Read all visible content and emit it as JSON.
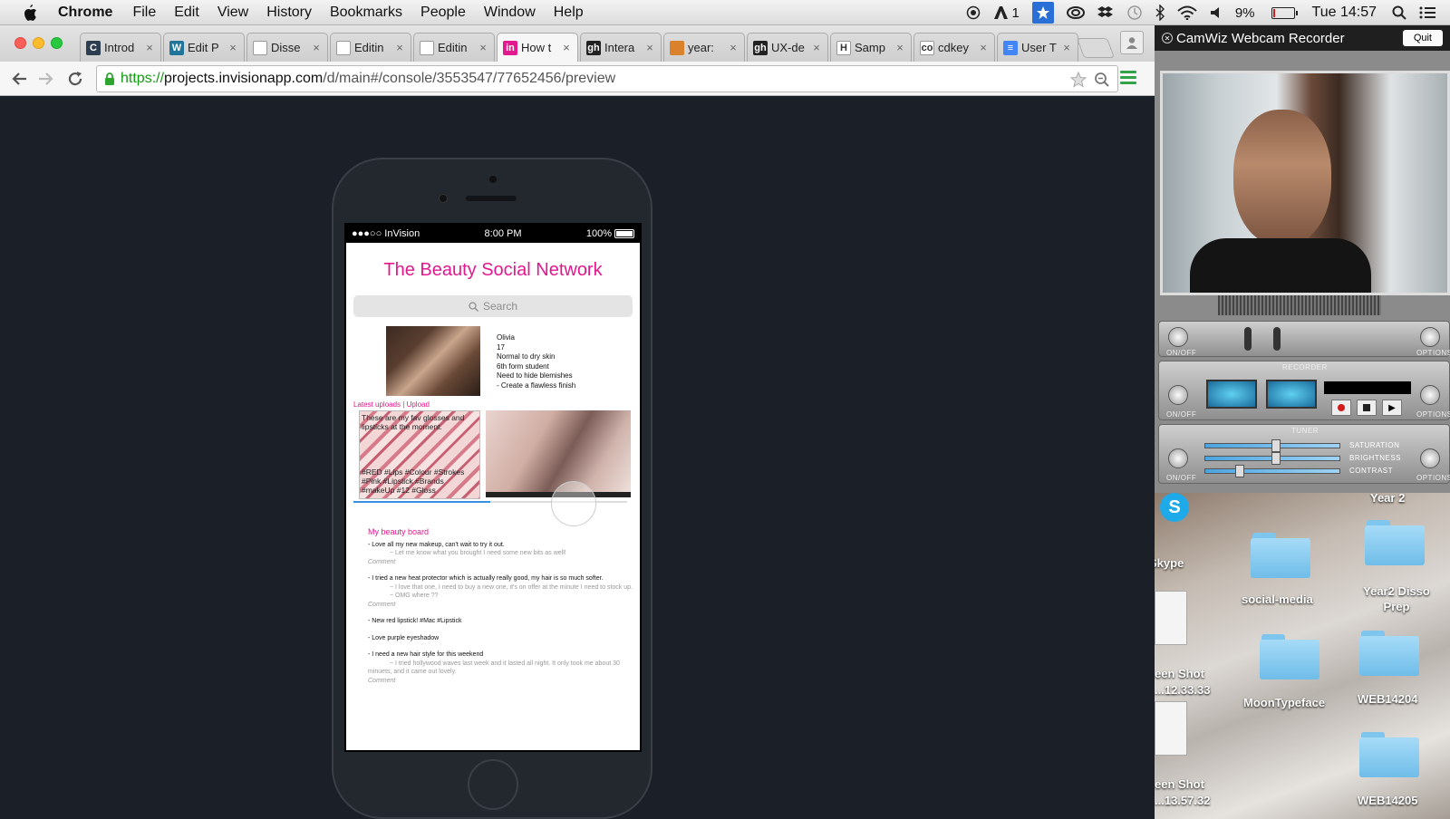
{
  "menubar": {
    "app": "Chrome",
    "items": [
      "File",
      "Edit",
      "View",
      "History",
      "Bookmarks",
      "People",
      "Window",
      "Help"
    ],
    "status": {
      "adobe_count": "1",
      "battery": "9%",
      "battery_level": 0.09,
      "clock": "Tue 14:57"
    }
  },
  "browser": {
    "tabs": [
      {
        "label": "Introd",
        "icon": "C",
        "color": "#2c3e50"
      },
      {
        "label": "Edit P",
        "icon": "W",
        "color": "#21759b"
      },
      {
        "label": "Disse",
        "icon": "",
        "color": "#ffffff"
      },
      {
        "label": "Editin",
        "icon": "",
        "color": "#ffffff"
      },
      {
        "label": "Editin",
        "icon": "",
        "color": "#ffffff"
      },
      {
        "label": "How t",
        "icon": "in",
        "color": "#e2188e"
      },
      {
        "label": "Intera",
        "icon": "gh",
        "color": "#222222"
      },
      {
        "label": "year: ",
        "icon": "",
        "color": "#d9822b"
      },
      {
        "label": "UX-de",
        "icon": "gh",
        "color": "#222222"
      },
      {
        "label": "Samp",
        "icon": "H",
        "color": "#ffffff"
      },
      {
        "label": "cdkey",
        "icon": "co",
        "color": "#ffffff"
      },
      {
        "label": "User T",
        "icon": "≡",
        "color": "#4285f4"
      }
    ],
    "active_tab": 5,
    "url": {
      "scheme": "https://",
      "host": "projects.invisionapp.com",
      "path": "/d/main#/console/3553547/77652456/preview"
    }
  },
  "phone": {
    "status": {
      "carrier": "●●●○○ InVision",
      "time": "8:00 PM",
      "battery": "100%"
    },
    "title": "The Beauty Social Network",
    "search_placeholder": "Search",
    "profile": {
      "name": "Olivia",
      "age": "17",
      "skin": "Normal to dry skin",
      "occupation": "6th form student",
      "need": "Need to hide blemishes",
      "goal": "- Create a flawless finish"
    },
    "uploads_label": "Latest uploads | Upload",
    "upload1": {
      "caption": "These are my fav glosses and lipsticks at the moment.",
      "tags": "#RED #Lips #Colour #Strokes #Pink #Lipstick #Brands #makeUp #12 #Gloss"
    },
    "progress": 0.5,
    "board": {
      "title": "My beauty board",
      "posts": [
        {
          "text": "- Love all my new makeup, can't wait to try it out.",
          "replies": [
            "~ Let me know what you brought I need some new bits as well!"
          ],
          "comment": "Comment"
        },
        {
          "text": "- I tried a new heat protector which is actually really good, my hair is so much softer.",
          "replies": [
            "~ I love that one, I need to buy a new one, it's on offer at the minute I need to stock up.",
            "~ OMG where ??"
          ],
          "comment": "Comment"
        },
        {
          "text": "- New red lipstick! #Mac #Lipstick",
          "replies": [],
          "comment": ""
        },
        {
          "text": "- Love purple eyeshadow",
          "replies": [],
          "comment": ""
        },
        {
          "text": "- I need a new hair style for this weekend",
          "replies": [
            "~ I tried hollywood waves last week and it lasted all night. It only took me about 30 minuets, and it came out lovely."
          ],
          "comment": "Comment"
        }
      ]
    }
  },
  "camwiz": {
    "title": "CamWiz Webcam Recorder",
    "quit": "Quit",
    "onoff": "ON/OFF",
    "options": "OPTIONS",
    "recorder": "RECORDER",
    "tuner": "TUNER",
    "saturation": "SATURATION",
    "brightness": "BRIGHTNESS",
    "contrast": "CONTRAST"
  },
  "desktop": {
    "items": {
      "skype": "Skype",
      "year2": "Year 2",
      "social": "social-media",
      "disso": "Year2 Disso Prep",
      "shot1_a": "een Shot",
      "shot1_b": "...12.33.33",
      "moon": "MoonTypeface",
      "web1": "WEB14204",
      "shot2_a": "een Shot",
      "shot2_b": "...13.57.32",
      "web2": "WEB14205"
    }
  }
}
